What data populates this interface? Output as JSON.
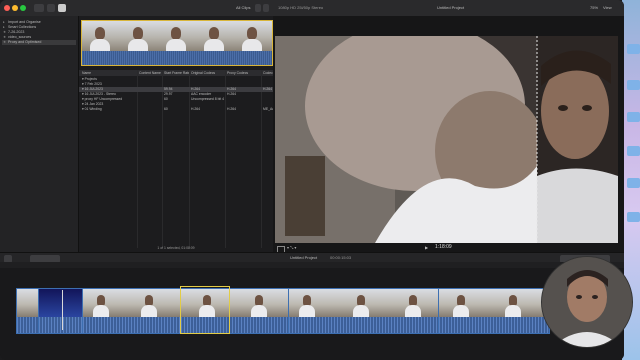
{
  "topbar": {
    "library_label": "All Clips",
    "viewer_title": "1080p HD 25i/50p Stereo",
    "project_label": "Untitled Project",
    "zoom_label": "75%",
    "view_label": "View"
  },
  "sidebar": {
    "items": [
      {
        "label": "Import and Organise",
        "selected": false
      },
      {
        "label": "Smart Collections",
        "selected": false
      },
      {
        "label": "7-26-2023",
        "selected": false
      },
      {
        "label": "video_sources",
        "selected": false
      },
      {
        "label": "Proxy and Optimised",
        "selected": true
      }
    ]
  },
  "browser": {
    "columns": [
      "Name",
      "Content Name",
      "Start Frame Rate",
      "Original Codecs",
      "Proxy Codecs",
      "Codec"
    ],
    "rows": [
      {
        "name": "▾ Projects",
        "cells": [
          "",
          "",
          "",
          "",
          ""
        ],
        "selected": false
      },
      {
        "name": "▾ 7 Feb 2023",
        "cells": [
          "",
          "",
          "",
          "",
          ""
        ],
        "selected": false
      },
      {
        "name": "▾ 16 JUL2023",
        "cells": [
          "",
          "59.94",
          "H.264",
          "H.264",
          "H.264"
        ],
        "selected": true
      },
      {
        "name": "▾ 16 JUL2023 - Stereo",
        "cells": [
          "",
          "29.97",
          "AAC encoder",
          "H.264",
          ""
        ],
        "selected": false
      },
      {
        "name": "▾ proxy HF Uncompressed",
        "cells": [
          "",
          "60",
          "Uncompressed 8 bit 4",
          "",
          ""
        ],
        "selected": false
      },
      {
        "name": "▾ 24 Jan 2023",
        "cells": [
          "",
          "",
          "",
          "",
          ""
        ],
        "selected": false
      },
      {
        "name": "▾ 01 Winding",
        "cells": [
          "",
          "60",
          "H.264",
          "H.264",
          "ME_Act"
        ],
        "selected": false
      }
    ],
    "status": "1 of 1 selected, 01:08:09"
  },
  "viewer": {
    "timecode": "1:18:09",
    "zoom": "75%"
  },
  "timeline": {
    "project_name": "Untitled Project",
    "duration": "00:00:15:03"
  },
  "colors": {
    "accent_yellow": "#e2cc46",
    "clip_blue": "#3d6fb1",
    "selection": "#3c3c40"
  }
}
